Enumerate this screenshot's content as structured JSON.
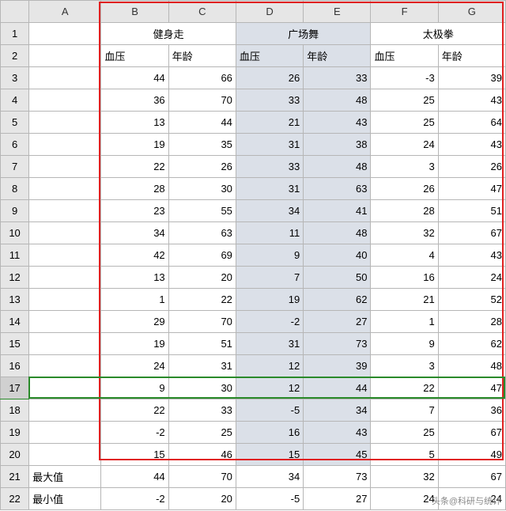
{
  "columns": [
    "A",
    "B",
    "C",
    "D",
    "E",
    "F",
    "G"
  ],
  "row_headers": [
    "1",
    "2",
    "3",
    "4",
    "5",
    "6",
    "7",
    "8",
    "9",
    "10",
    "11",
    "12",
    "13",
    "14",
    "15",
    "16",
    "17",
    "18",
    "19",
    "20",
    "21",
    "22"
  ],
  "groups": {
    "bc": "健身走",
    "de": "广场舞",
    "fg": "太极拳"
  },
  "subheaders": {
    "bp": "血压",
    "age": "年龄"
  },
  "labels": {
    "max": "最大值",
    "min": "最小值"
  },
  "data": [
    {
      "b": 44,
      "c": 66,
      "d": 26,
      "e": 33,
      "f": -3,
      "g": 39
    },
    {
      "b": 36,
      "c": 70,
      "d": 33,
      "e": 48,
      "f": 25,
      "g": 43
    },
    {
      "b": 13,
      "c": 44,
      "d": 21,
      "e": 43,
      "f": 25,
      "g": 64
    },
    {
      "b": 19,
      "c": 35,
      "d": 31,
      "e": 38,
      "f": 24,
      "g": 43
    },
    {
      "b": 22,
      "c": 26,
      "d": 33,
      "e": 48,
      "f": 3,
      "g": 26
    },
    {
      "b": 28,
      "c": 30,
      "d": 31,
      "e": 63,
      "f": 26,
      "g": 47
    },
    {
      "b": 23,
      "c": 55,
      "d": 34,
      "e": 41,
      "f": 28,
      "g": 51
    },
    {
      "b": 34,
      "c": 63,
      "d": 11,
      "e": 48,
      "f": 32,
      "g": 67
    },
    {
      "b": 42,
      "c": 69,
      "d": 9,
      "e": 40,
      "f": 4,
      "g": 43
    },
    {
      "b": 13,
      "c": 20,
      "d": 7,
      "e": 50,
      "f": 16,
      "g": 24
    },
    {
      "b": 1,
      "c": 22,
      "d": 19,
      "e": 62,
      "f": 21,
      "g": 52
    },
    {
      "b": 29,
      "c": 70,
      "d": -2,
      "e": 27,
      "f": 1,
      "g": 28
    },
    {
      "b": 19,
      "c": 51,
      "d": 31,
      "e": 73,
      "f": 9,
      "g": 62
    },
    {
      "b": 24,
      "c": 31,
      "d": 12,
      "e": 39,
      "f": 3,
      "g": 48
    },
    {
      "b": 9,
      "c": 30,
      "d": 12,
      "e": 44,
      "f": 22,
      "g": 47
    },
    {
      "b": 22,
      "c": 33,
      "d": -5,
      "e": 34,
      "f": 7,
      "g": 36
    },
    {
      "b": -2,
      "c": 25,
      "d": 16,
      "e": 43,
      "f": 25,
      "g": 67
    },
    {
      "b": 15,
      "c": 46,
      "d": 15,
      "e": 45,
      "f": 5,
      "g": 49
    }
  ],
  "summary": {
    "max": {
      "b": 44,
      "c": 70,
      "d": 34,
      "e": 73,
      "f": 32,
      "g": 67
    },
    "min": {
      "b": -2,
      "c": 20,
      "d": -5,
      "e": 27,
      "f": 24,
      "g": 24
    }
  },
  "watermark": "头条@科研与统计"
}
